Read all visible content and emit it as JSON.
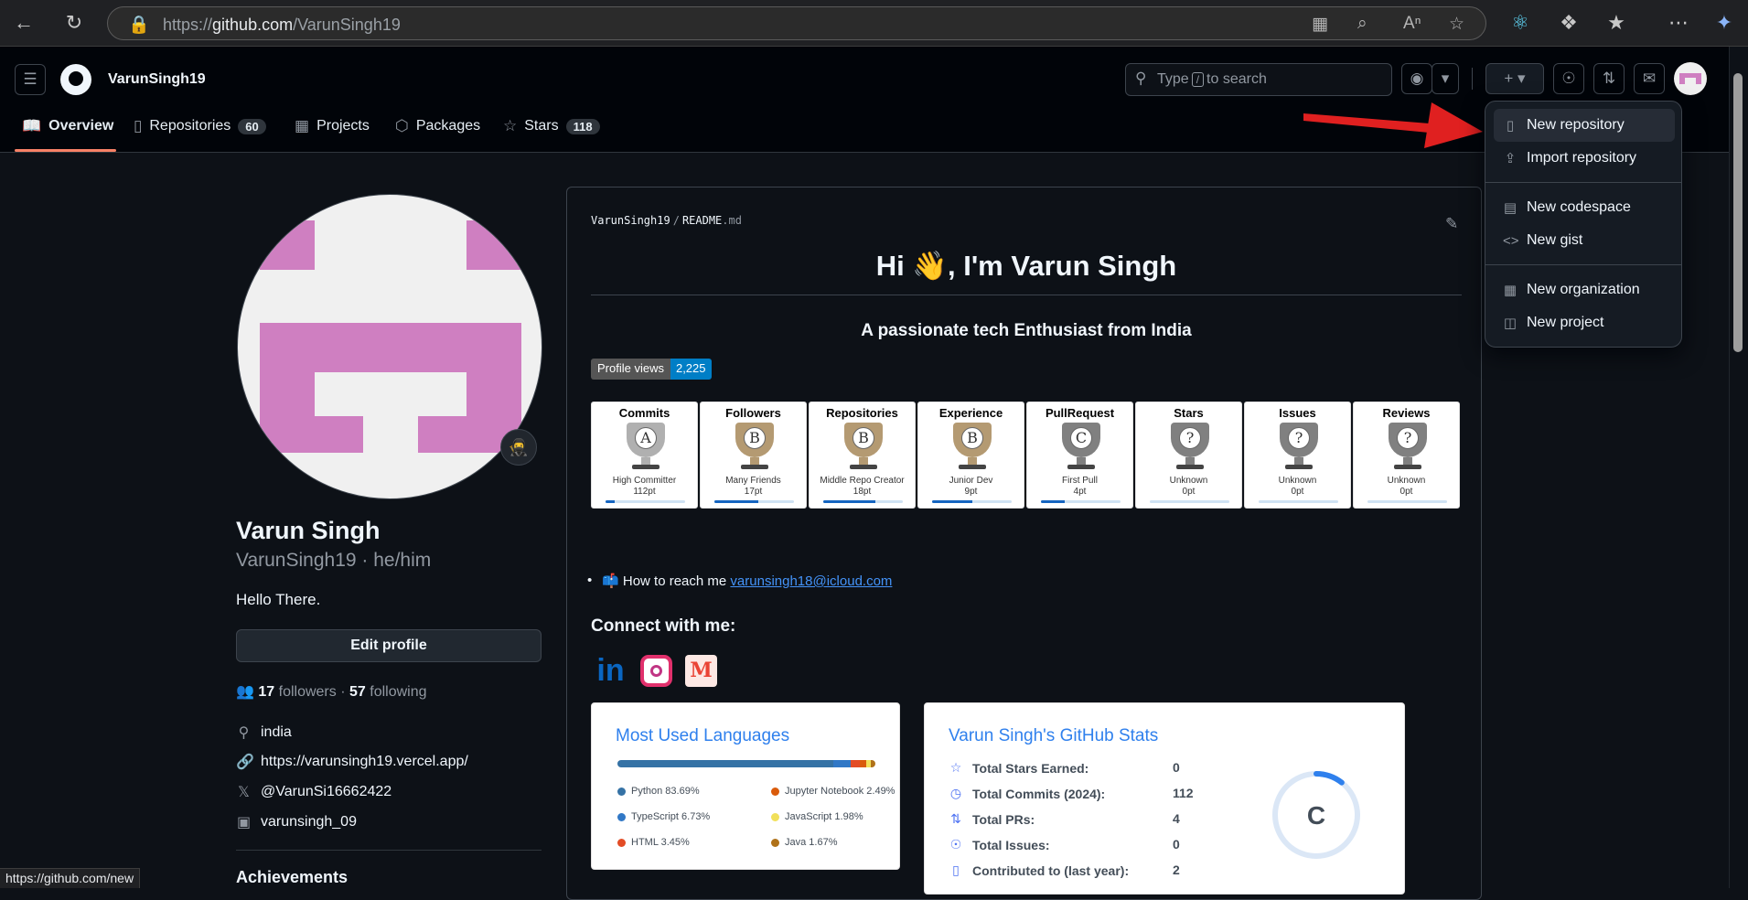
{
  "browser": {
    "url_prefix": "https://",
    "url_host": "github.com",
    "url_path": "/VarunSingh19",
    "status_url": "https://github.com/new"
  },
  "header": {
    "username": "VarunSingh19",
    "search_type": "Type",
    "search_key": "/",
    "search_suffix": "to search"
  },
  "nav": {
    "tabs": [
      {
        "label": "Overview",
        "icon": "book-icon"
      },
      {
        "label": "Repositories",
        "count": "60",
        "icon": "repo-icon"
      },
      {
        "label": "Projects",
        "icon": "table-icon"
      },
      {
        "label": "Packages",
        "icon": "package-icon"
      },
      {
        "label": "Stars",
        "count": "118",
        "icon": "star-icon"
      }
    ]
  },
  "profile": {
    "full_name": "Varun Singh",
    "login_pronouns": "VarunSingh19 · he/him",
    "bio": "Hello There.",
    "edit_label": "Edit profile",
    "followers_count": "17",
    "followers_label": "followers",
    "dot": "·",
    "following_count": "57",
    "following_label": "following",
    "location": "india",
    "website": "https://varunsingh19.vercel.app/",
    "twitter": "@VarunSi16662422",
    "instagram": "varunsingh_09",
    "achievements": "Achievements"
  },
  "readme": {
    "path_user": "VarunSingh19",
    "path_sep": "/",
    "path_file": "README",
    "path_ext": ".md",
    "title": "Hi 👋, I'm Varun Singh",
    "tagline": "A passionate tech Enthusiast from India",
    "views_label": "Profile views",
    "views_count": "2,225",
    "reach_emoji": "📫",
    "reach_text": "How to reach me",
    "reach_email": "varunsingh18@icloud.com",
    "connect_title": "Connect with me:"
  },
  "trophies": [
    {
      "title": "Commits",
      "letter": "A",
      "rank": "High Committer",
      "pt": "112pt",
      "progress": 0.12,
      "color": "#b0b0b0"
    },
    {
      "title": "Followers",
      "letter": "B",
      "rank": "Many Friends",
      "pt": "17pt",
      "progress": 0.55,
      "color": "#b49a72"
    },
    {
      "title": "Repositories",
      "letter": "B",
      "rank": "Middle Repo Creator",
      "pt": "18pt",
      "progress": 0.65,
      "color": "#b49a72"
    },
    {
      "title": "Experience",
      "letter": "B",
      "rank": "Junior Dev",
      "pt": "9pt",
      "progress": 0.5,
      "color": "#b49a72"
    },
    {
      "title": "PullRequest",
      "letter": "C",
      "rank": "First Pull",
      "pt": "4pt",
      "progress": 0.3,
      "color": "#808080"
    },
    {
      "title": "Stars",
      "letter": "?",
      "rank": "Unknown",
      "pt": "0pt",
      "progress": 0.0,
      "color": "#808080"
    },
    {
      "title": "Issues",
      "letter": "?",
      "rank": "Unknown",
      "pt": "0pt",
      "progress": 0.0,
      "color": "#808080"
    },
    {
      "title": "Reviews",
      "letter": "?",
      "rank": "Unknown",
      "pt": "0pt",
      "progress": 0.0,
      "color": "#808080"
    }
  ],
  "languages": {
    "title": "Most Used Languages",
    "items": [
      {
        "name": "Python 83.69%",
        "pct": 83.69,
        "color": "#3572a5"
      },
      {
        "name": "Jupyter Notebook 2.49%",
        "pct": 2.49,
        "color": "#da5b0b"
      },
      {
        "name": "TypeScript 6.73%",
        "pct": 6.73,
        "color": "#3178c6"
      },
      {
        "name": "JavaScript 1.98%",
        "pct": 1.98,
        "color": "#f1e05a"
      },
      {
        "name": "HTML 3.45%",
        "pct": 3.45,
        "color": "#e34c26"
      },
      {
        "name": "Java 1.67%",
        "pct": 1.67,
        "color": "#b07219"
      }
    ]
  },
  "stats": {
    "title": "Varun Singh's GitHub Stats",
    "grade": "C",
    "rows": [
      {
        "label": "Total Stars Earned:",
        "value": "0",
        "icon": "star-icon"
      },
      {
        "label": "Total Commits (2024):",
        "value": "112",
        "icon": "history-icon"
      },
      {
        "label": "Total PRs:",
        "value": "4",
        "icon": "pr-icon"
      },
      {
        "label": "Total Issues:",
        "value": "0",
        "icon": "issue-icon"
      },
      {
        "label": "Contributed to (last year):",
        "value": "2",
        "icon": "repo-icon"
      }
    ]
  },
  "new_menu": {
    "items": [
      {
        "label": "New repository",
        "icon": "repo-icon"
      },
      {
        "label": "Import repository",
        "icon": "repo-push-icon"
      },
      {
        "label": "New codespace",
        "icon": "codespace-icon"
      },
      {
        "label": "New gist",
        "icon": "code-icon"
      },
      {
        "label": "New organization",
        "icon": "organization-icon"
      },
      {
        "label": "New project",
        "icon": "project-icon"
      }
    ]
  },
  "colors": {
    "annotation_arrow": "#e02020",
    "accent_underline": "#f78166",
    "avatar_pink": "#cf7fc1"
  }
}
